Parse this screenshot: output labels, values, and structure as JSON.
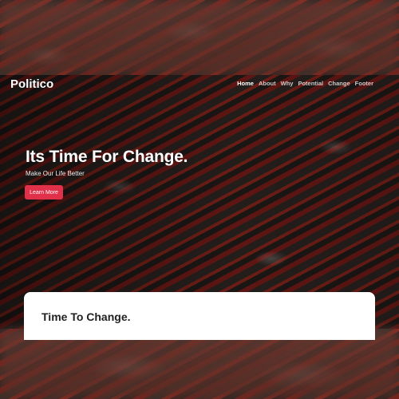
{
  "navbar": {
    "brand": "Politico",
    "links": [
      {
        "label": "Home",
        "active": true
      },
      {
        "label": "About"
      },
      {
        "label": "Why"
      },
      {
        "label": "Potential"
      },
      {
        "label": "Change"
      },
      {
        "label": "Footer"
      }
    ]
  },
  "hero": {
    "title": "Its Time For Change.",
    "subtitle": "Make Our Life Better",
    "cta_label": "Learn More",
    "cta_color": "#e0304a"
  },
  "section": {
    "title": "Time To Change."
  }
}
